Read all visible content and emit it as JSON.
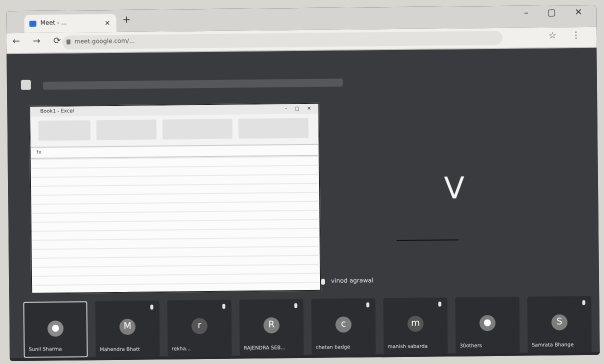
{
  "browser": {
    "tab_title": "Meet - ...",
    "address": "meet.google.com/...",
    "new_tab_symbol": "+",
    "close_symbol": "×"
  },
  "shared_window": {
    "title": "Book1 - Excel",
    "formula_bar": "fx",
    "rows": [
      "",
      ""
    ]
  },
  "main_participant": {
    "initial": "V",
    "name": "vinod agrawal"
  },
  "participants": [
    {
      "name": "Sunil Sharma",
      "initial": "",
      "kind": "photo",
      "active": true
    },
    {
      "name": "Mahendra Bhatt",
      "initial": "M",
      "kind": "letter"
    },
    {
      "name": "rekha...",
      "initial": "r",
      "kind": "letter"
    },
    {
      "name": "RAJENDRA SEB...",
      "initial": "R",
      "kind": "letter"
    },
    {
      "name": "chetan badge",
      "initial": "c",
      "kind": "letter"
    },
    {
      "name": "manish sabarda",
      "initial": "m",
      "kind": "letter"
    },
    {
      "name": "30others",
      "initial": "",
      "kind": "group"
    },
    {
      "name": "Samrata Bhange",
      "initial": "S",
      "kind": "letter"
    }
  ],
  "colors": {
    "stage": "#3a3b3e",
    "tile": "#2c2d30",
    "chrome": "#d5d4d0"
  }
}
